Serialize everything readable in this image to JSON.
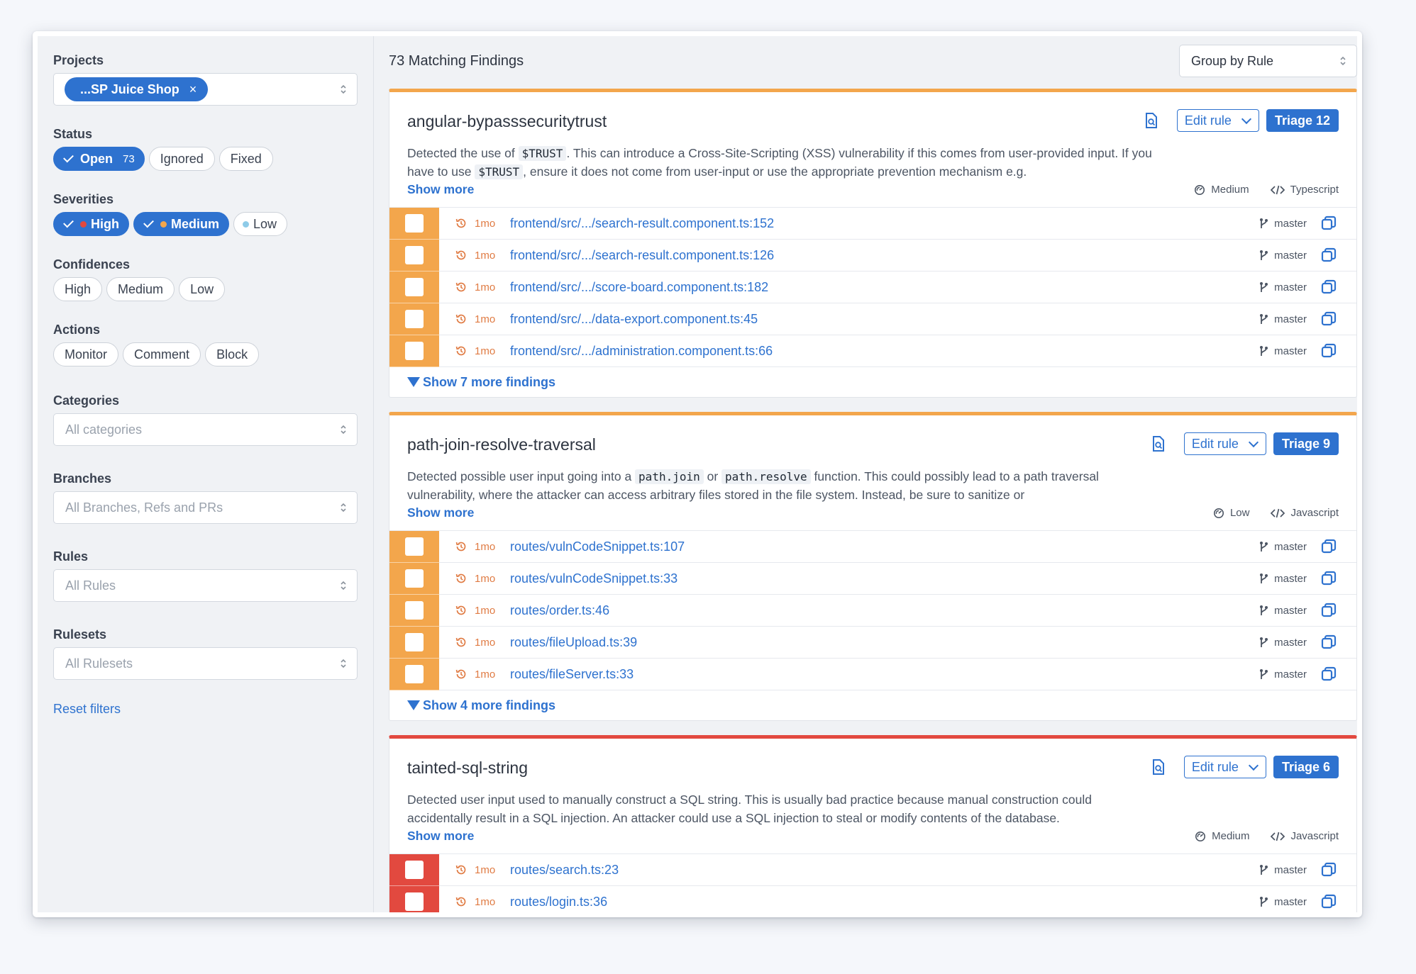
{
  "sidebar": {
    "projects": {
      "label": "Projects",
      "selected": "...SP Juice Shop",
      "remove": "×"
    },
    "status": {
      "label": "Status",
      "options": [
        {
          "label": "Open",
          "count": "73",
          "active": true
        },
        {
          "label": "Ignored",
          "active": false
        },
        {
          "label": "Fixed",
          "active": false
        }
      ]
    },
    "severities": {
      "label": "Severities",
      "options": [
        {
          "label": "High",
          "active": true,
          "dot": "#e2493f"
        },
        {
          "label": "Medium",
          "active": true,
          "dot": "#f3a64c"
        },
        {
          "label": "Low",
          "active": false,
          "dot": "#8ecbe8"
        }
      ]
    },
    "confidences": {
      "label": "Confidences",
      "options": [
        "High",
        "Medium",
        "Low"
      ]
    },
    "actions": {
      "label": "Actions",
      "options": [
        "Monitor",
        "Comment",
        "Block"
      ]
    },
    "categories": {
      "label": "Categories",
      "placeholder": "All categories"
    },
    "branches": {
      "label": "Branches",
      "placeholder": "All Branches, Refs and PRs"
    },
    "rules": {
      "label": "Rules",
      "placeholder": "All Rules"
    },
    "rulesets": {
      "label": "Rulesets",
      "placeholder": "All Rulesets"
    },
    "reset": "Reset filters"
  },
  "main": {
    "title": "73 Matching Findings",
    "group_by": "Group by Rule",
    "edit_rule": "Edit rule",
    "show_more": "Show more",
    "cards": [
      {
        "rule": "angular-bypasssecuritytrust",
        "triage": "Triage 12",
        "color": "#f3a64c",
        "desc1": "Detected the use of ",
        "code1": "$TRUST",
        "desc2": ". This can introduce a Cross-Site-Scripting (XSS) vulnerability if this comes from user-provided input. If you have to use ",
        "code2": "$TRUST",
        "desc3": ", ensure it does not come from user-input or use the appropriate prevention mechanism e.g.",
        "confidence": "Medium",
        "language": "Typescript",
        "findings": [
          {
            "age": "1mo",
            "file": "frontend/src/.../search-result.component.ts:152",
            "branch": "master"
          },
          {
            "age": "1mo",
            "file": "frontend/src/.../search-result.component.ts:126",
            "branch": "master"
          },
          {
            "age": "1mo",
            "file": "frontend/src/.../score-board.component.ts:182",
            "branch": "master"
          },
          {
            "age": "1mo",
            "file": "frontend/src/.../data-export.component.ts:45",
            "branch": "master"
          },
          {
            "age": "1mo",
            "file": "frontend/src/.../administration.component.ts:66",
            "branch": "master"
          }
        ],
        "more": "Show 7 more findings"
      },
      {
        "rule": "path-join-resolve-traversal",
        "triage": "Triage 9",
        "color": "#f3a64c",
        "desc1": "Detected possible user input going into a ",
        "code1": "path.join",
        "desc2": " or ",
        "code2": "path.resolve",
        "desc3": " function. This could possibly lead to a path traversal vulnerability, where the attacker can access arbitrary files stored in the file system. Instead, be sure to sanitize or",
        "confidence": "Low",
        "language": "Javascript",
        "findings": [
          {
            "age": "1mo",
            "file": "routes/vulnCodeSnippet.ts:107",
            "branch": "master"
          },
          {
            "age": "1mo",
            "file": "routes/vulnCodeSnippet.ts:33",
            "branch": "master"
          },
          {
            "age": "1mo",
            "file": "routes/order.ts:46",
            "branch": "master"
          },
          {
            "age": "1mo",
            "file": "routes/fileUpload.ts:39",
            "branch": "master"
          },
          {
            "age": "1mo",
            "file": "routes/fileServer.ts:33",
            "branch": "master"
          }
        ],
        "more": "Show 4 more findings"
      },
      {
        "rule": "tainted-sql-string",
        "triage": "Triage 6",
        "color": "#e2493f",
        "desc1": "Detected user input used to manually construct a SQL string. This is usually bad practice because manual construction could accidentally result in a SQL injection. An attacker could use a SQL injection to steal or modify contents of the database.",
        "confidence": "Medium",
        "language": "Javascript",
        "findings": [
          {
            "age": "1mo",
            "file": "routes/search.ts:23",
            "branch": "master"
          },
          {
            "age": "1mo",
            "file": "routes/login.ts:36",
            "branch": "master"
          }
        ]
      }
    ]
  }
}
